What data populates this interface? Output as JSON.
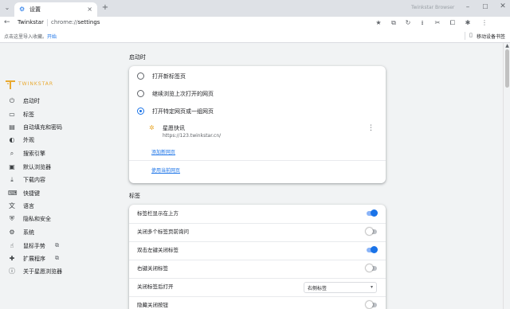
{
  "tab": {
    "title": "设置",
    "close": "×"
  },
  "window": {
    "brand": "Twinkstar Browser",
    "min": "–",
    "max": "☐",
    "close": "✕",
    "tab_menu": "⌄",
    "new_tab": "+"
  },
  "toolbar": {
    "back": "←",
    "brand": "Twinkstar",
    "url_scheme": "chrome://",
    "url_path": "settings",
    "icons": [
      "★",
      "⧉",
      "↻",
      "⭳",
      "✂",
      "⧠",
      "✱",
      "⋮"
    ]
  },
  "bookmarks": {
    "prompt": "点击这里导入收藏。",
    "start": "开始",
    "mobile": "移动设备书签",
    "mobile_icon": "▯"
  },
  "logo": {
    "text": "TWINKSTAR"
  },
  "sidebar": {
    "items": [
      {
        "icon": "⏻",
        "label": "启动时"
      },
      {
        "icon": "▭",
        "label": "标签"
      },
      {
        "icon": "▤",
        "label": "自动填充和密码"
      },
      {
        "icon": "◐",
        "label": "外观"
      },
      {
        "icon": "⌕",
        "label": "搜索引擎"
      },
      {
        "icon": "▣",
        "label": "默认浏览器"
      },
      {
        "icon": "⤓",
        "label": "下载内容"
      },
      {
        "icon": "⌨",
        "label": "快捷键"
      },
      {
        "icon": "文",
        "label": "语言"
      },
      {
        "icon": "⛨",
        "label": "隐私和安全"
      },
      {
        "icon": "⚙",
        "label": "系统"
      },
      {
        "icon": "☝",
        "label": "鼠标手势",
        "ext": "⧉"
      },
      {
        "icon": "✚",
        "label": "扩展程序",
        "ext": "⧉"
      },
      {
        "icon": "ⓘ",
        "label": "关于星愿浏览器"
      }
    ]
  },
  "startup": {
    "title": "启动时",
    "options": [
      {
        "label": "打开新标签页",
        "selected": false
      },
      {
        "label": "继续浏览上次打开的网页",
        "selected": false
      },
      {
        "label": "打开特定网页或一组网页",
        "selected": true
      }
    ],
    "site": {
      "icon": "✲",
      "name": "星愿快讯",
      "url": "https://123.twinkstar.cn/",
      "more": "⋮"
    },
    "add_link": "添加新网页",
    "use_current_link": "使用当前网页"
  },
  "tabs_section": {
    "title": "标签",
    "rows": [
      {
        "label": "标签栏显示在上方",
        "on": true
      },
      {
        "label": "关闭多个标签页前询问",
        "on": false
      },
      {
        "label": "双击左键关闭标签",
        "on": true
      },
      {
        "label": "右键关闭标签",
        "on": false
      }
    ],
    "after_close": {
      "label": "关闭标签后打开",
      "value": "右侧标签",
      "caret": "▾"
    },
    "last_row": {
      "label": "隐藏关闭按钮",
      "on": false
    }
  },
  "scrollbar": {
    "up": "▲"
  },
  "colors": {
    "accent": "#1a73e8",
    "brand": "#e9a92f",
    "background": "#f1f3f4"
  }
}
